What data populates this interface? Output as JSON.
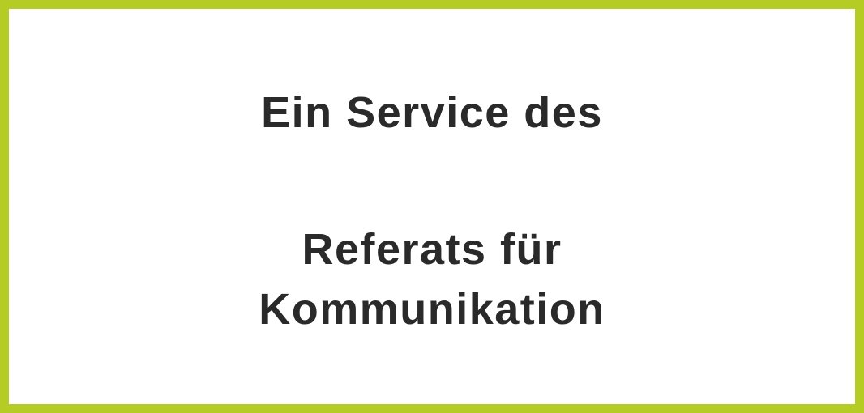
{
  "banner": {
    "line1": "Ein Service des",
    "line2": "Referats für",
    "line3": "Kommunikation"
  },
  "colors": {
    "border": "#b5cc25",
    "background": "#ffffff",
    "text": "#2a2a2a"
  }
}
